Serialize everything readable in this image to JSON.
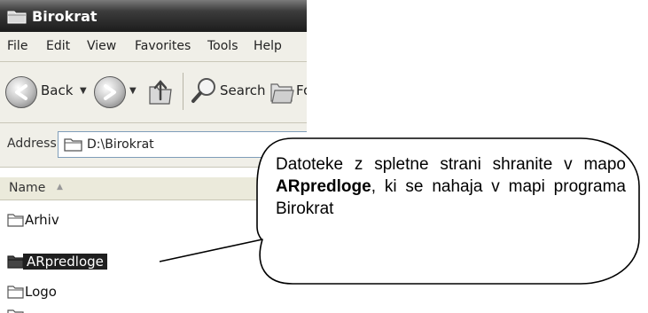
{
  "window": {
    "title": "Birokrat"
  },
  "menu": [
    "File",
    "Edit",
    "View",
    "Favorites",
    "Tools",
    "Help"
  ],
  "toolbar": {
    "back_label": "Back",
    "search_label": "Search",
    "folders_label": "Fo"
  },
  "address": {
    "label": "Address",
    "value": "D:\\Birokrat"
  },
  "list": {
    "column_name": "Name",
    "items": [
      "Arhiv",
      "ARpredloge",
      "Logo"
    ],
    "selected_index": 1
  },
  "callout": {
    "part1": "Datoteke z spletne strani shranite v mapo ",
    "bold": "ARpredloge",
    "part2": ", ki se nahaja v mapi programa Birokrat"
  }
}
